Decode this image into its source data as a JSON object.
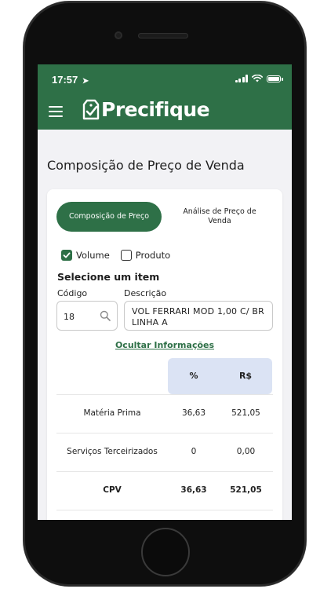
{
  "status_bar": {
    "time": "17:57",
    "location_arrow": "➤"
  },
  "app": {
    "brand": "Precifique"
  },
  "page": {
    "title": "Composição de Preço de Venda"
  },
  "segments": [
    {
      "label": "Composição de Preço",
      "active": true
    },
    {
      "label": "Análise de Preço de Venda",
      "active": false
    }
  ],
  "filters": {
    "volume": {
      "label": "Volume",
      "checked": true
    },
    "produto": {
      "label": "Produto",
      "checked": false
    }
  },
  "item_select": {
    "title": "Selecione um item",
    "code_label": "Código",
    "code_value": "18",
    "desc_label": "Descrição",
    "desc_value": "VOL FERRARI MOD 1,00 C/ BR LINHA A"
  },
  "toggle_info": {
    "label": "Ocultar Informações"
  },
  "table": {
    "headers": [
      "%",
      "R$"
    ],
    "rows": [
      {
        "name": "Matéria Prima",
        "pct": "36,63",
        "rs": "521,05"
      },
      {
        "name": "Serviços Terceirizados",
        "pct": "0",
        "rs": "0,00"
      },
      {
        "name": "CPV",
        "pct": "36,63",
        "rs": "521,05"
      }
    ]
  },
  "colors": {
    "brand_green": "#2e7047",
    "header_blue": "#dbe3f4"
  }
}
